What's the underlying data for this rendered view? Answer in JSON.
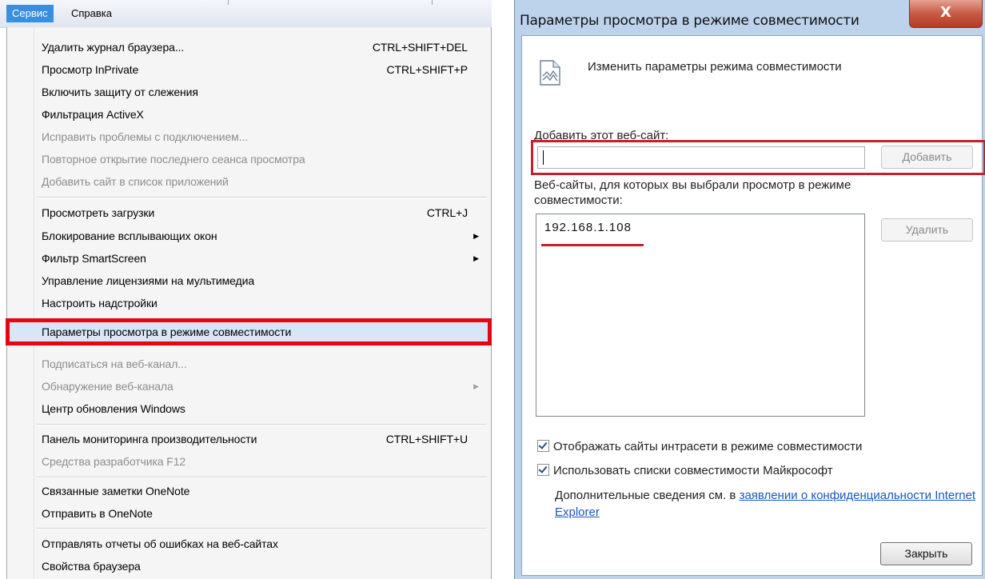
{
  "menubar": {
    "service": "Сервис",
    "help": "Справка"
  },
  "menu": {
    "items": [
      {
        "label": "Удалить журнал браузера...",
        "shortcut": "CTRL+SHIFT+DEL"
      },
      {
        "label": "Просмотр InPrivate",
        "shortcut": "CTRL+SHIFT+P"
      },
      {
        "label": "Включить защиту от слежения",
        "shortcut": ""
      },
      {
        "label": "Фильтрация ActiveX",
        "shortcut": ""
      },
      {
        "label": "Исправить проблемы с подключением...",
        "shortcut": "",
        "disabled": true
      },
      {
        "label": "Повторное открытие последнего сеанса просмотра",
        "shortcut": "",
        "disabled": true
      },
      {
        "label": "Добавить сайт в список приложений",
        "shortcut": "",
        "disabled": true
      },
      {
        "label": "Просмотреть загрузки",
        "shortcut": "CTRL+J"
      },
      {
        "label": "Блокирование всплывающих окон",
        "shortcut": "",
        "submenu": true
      },
      {
        "label": "Фильтр SmartScreen",
        "shortcut": "",
        "submenu": true
      },
      {
        "label": "Управление лицензиями на мультимедиа",
        "shortcut": ""
      },
      {
        "label": "Настроить надстройки",
        "shortcut": ""
      },
      {
        "label": "Параметры просмотра в режиме совместимости",
        "shortcut": "",
        "highlighted": true
      },
      {
        "label": "Подписаться на веб-канал...",
        "shortcut": "",
        "disabled": true
      },
      {
        "label": "Обнаружение веб-канала",
        "shortcut": "",
        "disabled": true,
        "submenu": true
      },
      {
        "label": "Центр обновления Windows",
        "shortcut": ""
      },
      {
        "label": "Панель мониторинга производительности",
        "shortcut": "CTRL+SHIFT+U"
      },
      {
        "label": "Средства разработчика F12",
        "shortcut": "",
        "disabled": true
      },
      {
        "label": "Связанные заметки OneNote",
        "shortcut": ""
      },
      {
        "label": "Отправить в OneNote",
        "shortcut": ""
      },
      {
        "label": "Отправлять отчеты об ошибках на веб-сайтах",
        "shortcut": ""
      },
      {
        "label": "Свойства браузера",
        "shortcut": ""
      }
    ],
    "submenu_arrow": "▶"
  },
  "dialog": {
    "title": "Параметры просмотра в режиме совместимости",
    "close_glyph": "X",
    "header": "Изменить параметры режима совместимости",
    "add_label": "Добавить этот веб-сайт:",
    "add_value": "",
    "add_button": "Добавить",
    "list_label": "Веб-сайты, для которых вы выбрали просмотр в режиме совместимости:",
    "sites": [
      "192.168.1.108"
    ],
    "remove_button": "Удалить",
    "check_intranet": "Отображать сайты интрасети в режиме совместимости",
    "check_intranet_checked": true,
    "check_ms_lists": "Использовать списки совместимости Майкрософт",
    "check_ms_lists_checked": true,
    "info_prefix": "Дополнительные сведения см. в ",
    "info_link": "заявлении о конфиденциальности Internet Explorer",
    "close_button": "Закрыть"
  },
  "colors": {
    "highlight_outline": "#e30613",
    "annotation_red": "#c0232c",
    "menu_active": "#3a8ee0"
  }
}
